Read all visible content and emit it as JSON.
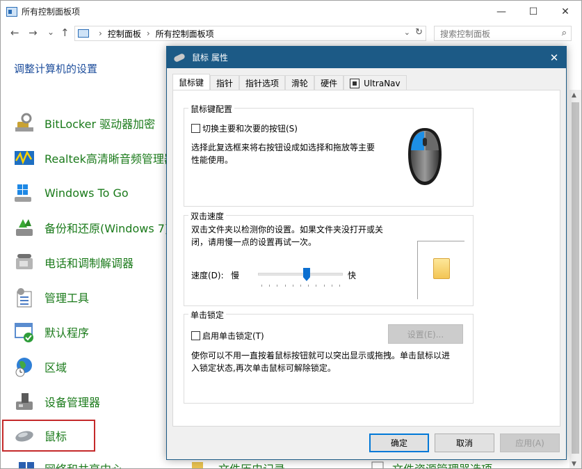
{
  "window": {
    "title": "所有控制面板项",
    "minimize": "—",
    "maximize": "☐",
    "close": "✕"
  },
  "nav": {
    "back": "←",
    "forward": "→",
    "recent": "⌄",
    "up": "↑",
    "breadcrumb": [
      "控制面板",
      "所有控制面板项"
    ],
    "breadcrumb_sep": "›",
    "dropdown": "⌄",
    "refresh": "↻",
    "search_placeholder": "搜索控制面板",
    "search_icon": "⌕"
  },
  "heading": "调整计算机的设置",
  "items": [
    {
      "label": "BitLocker 驱动器加密",
      "icon": "bitlocker-icon"
    },
    {
      "label": "Realtek高清晰音频管理器",
      "icon": "realtek-icon"
    },
    {
      "label": "Windows To Go",
      "icon": "windows-to-go-icon"
    },
    {
      "label": "备份和还原(Windows 7)",
      "icon": "backup-icon"
    },
    {
      "label": "电话和调制解调器",
      "icon": "phone-icon"
    },
    {
      "label": "管理工具",
      "icon": "admin-tools-icon"
    },
    {
      "label": "默认程序",
      "icon": "default-programs-icon"
    },
    {
      "label": "区域",
      "icon": "region-icon"
    },
    {
      "label": "设备管理器",
      "icon": "device-manager-icon"
    },
    {
      "label": "鼠标",
      "icon": "mouse-icon"
    }
  ],
  "bottom_row": [
    "网络和共享中心",
    "文件历史记录",
    "文件资源管理器选项"
  ],
  "dialog": {
    "title": "鼠标 属性",
    "close": "✕",
    "tabs": [
      "鼠标键",
      "指针",
      "指针选项",
      "滑轮",
      "硬件",
      "UltraNav"
    ],
    "active_tab": "鼠标键",
    "button_config": {
      "label": "鼠标键配置",
      "checkbox": "切换主要和次要的按钮(S)",
      "checked": false,
      "description": [
        "选择此复选框来将右按钮设成如选择和拖放等主要",
        "性能使用。"
      ]
    },
    "double_click": {
      "label": "双击速度",
      "description": [
        "双击文件夹以检测你的设置。如果文件夹没打开或关",
        "闭，请用慢一点的设置再试一次。"
      ],
      "speed_label": "速度(D):",
      "slow": "慢",
      "fast": "快",
      "value": 0.58,
      "ticks": 11
    },
    "click_lock": {
      "label": "单击锁定",
      "checkbox": "启用单击锁定(T)",
      "checked": false,
      "settings_button": "设置(E)...",
      "description": [
        "使你可以不用一直按着鼠标按钮就可以突出显示或拖拽。单击鼠标以进",
        "入锁定状态,再次单击鼠标可解除锁定。"
      ]
    },
    "buttons": {
      "ok": "确定",
      "cancel": "取消",
      "apply": "应用(A)"
    }
  },
  "colors": {
    "accent": "#0078d7",
    "dialog_title": "#1c5a86",
    "link_green": "#1a7a1a",
    "heading_blue": "#1e4e9c",
    "selection_red": "#c4292a"
  }
}
